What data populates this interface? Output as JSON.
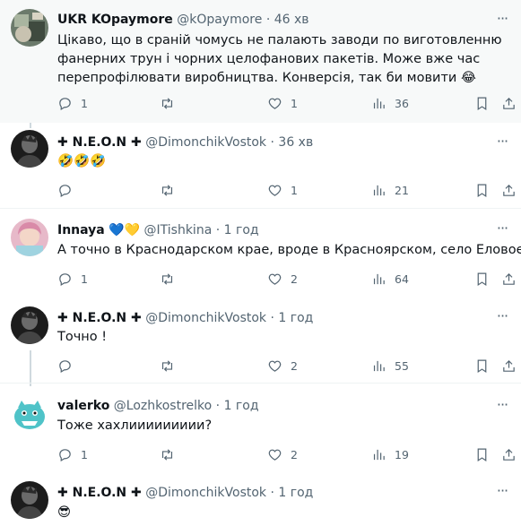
{
  "tweets": [
    {
      "name": "UKR KOpaymore",
      "handle": "@kOpaymore",
      "dot": "·",
      "time": "46 хв",
      "lines": [
        "Цікаво, що в сраній чомусь не палають заводи по виготовленню",
        "фанерних трун і чорних целофанових пакетів. Може вже час",
        "перепрофілювати виробництва. Конверсія, так би мовити 😂"
      ],
      "replies": "1",
      "retweets": "",
      "likes": "1",
      "views": "36"
    },
    {
      "name": "✚ N.E.O.N ✚",
      "handle": "@DimonchikVostok",
      "dot": "·",
      "time": "36 хв",
      "lines": [
        "🤣🤣🤣"
      ],
      "replies": "",
      "retweets": "",
      "likes": "1",
      "views": "21"
    },
    {
      "name": "Innaya",
      "hearts": [
        "💙",
        "💛"
      ],
      "handle": "@ITishkina",
      "dot": "·",
      "time": "1 год",
      "lines": [
        "А точно в Краснодарском крае, вроде в Красноярском, село Еловое"
      ],
      "replies": "1",
      "retweets": "",
      "likes": "2",
      "views": "64"
    },
    {
      "name": "✚ N.E.O.N ✚",
      "handle": "@DimonchikVostok",
      "dot": "·",
      "time": "1 год",
      "lines": [
        "Точно !"
      ],
      "replies": "",
      "retweets": "",
      "likes": "2",
      "views": "55"
    },
    {
      "name": "valerko",
      "handle": "@Lozhkostrelko",
      "dot": "·",
      "time": "1 год",
      "lines": [
        "Тоже хахлиииииииии?"
      ],
      "replies": "1",
      "retweets": "",
      "likes": "2",
      "views": "19"
    },
    {
      "name": "✚ N.E.O.N ✚",
      "handle": "@DimonchikVostok",
      "dot": "·",
      "time": "1 год",
      "lines": [
        "😎"
      ],
      "replies": "",
      "retweets": "",
      "likes": "",
      "views": ""
    }
  ],
  "colors": {
    "text": "#0f1419",
    "secondary": "#536471",
    "thread_line": "#cfd9de",
    "highlight_bg": "#f7f9f9"
  },
  "icons": [
    "more-icon",
    "reply-icon",
    "retweet-icon",
    "like-icon",
    "views-icon",
    "bookmark-icon",
    "share-icon"
  ]
}
